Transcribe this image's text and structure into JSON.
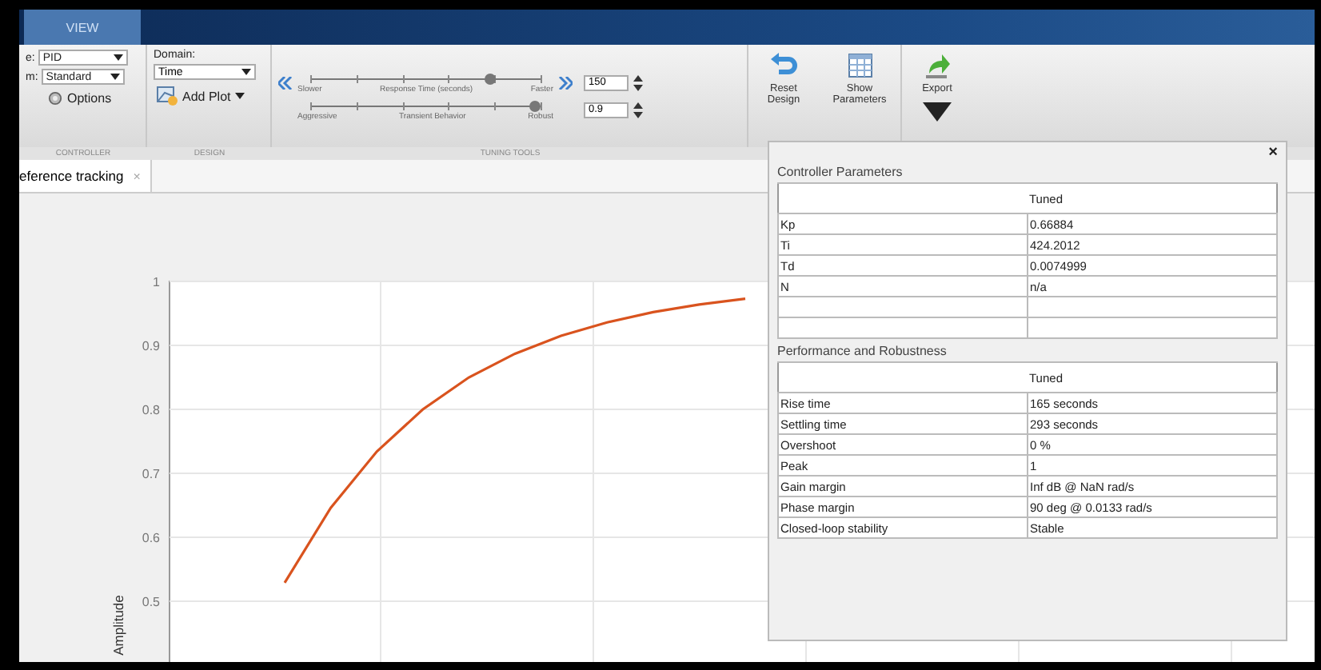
{
  "ribbon_tabs": [
    {
      "label": "VIEW",
      "selected": true
    }
  ],
  "controller": {
    "type_label": "e:",
    "type_value": "PID",
    "form_label": "m:",
    "form_value": "Standard",
    "options_button": "Options",
    "section": "CONTROLLER"
  },
  "design": {
    "domain_label": "Domain:",
    "domain_value": "Time",
    "add_plot_button": "Add Plot",
    "section": "DESIGN"
  },
  "tuning_tools": {
    "section": "TUNING TOOLS",
    "sliders": [
      {
        "left": "Slower",
        "center": "Response Time (seconds)",
        "right": "Faster",
        "level": 0.78,
        "value": "150"
      },
      {
        "left": "Aggressive",
        "center": "Transient Behavior",
        "right": "Robust",
        "level": 0.97,
        "value": "0.9"
      }
    ]
  },
  "buttons": [
    {
      "kind": "reset",
      "label": "Reset Design"
    },
    {
      "kind": "table",
      "label": "Show Parameters"
    },
    {
      "kind": "export",
      "label": "Export"
    }
  ],
  "document_tabs": [
    {
      "label": "eference tracking",
      "close": "×",
      "selected": true
    }
  ],
  "plot": {
    "chart_data": {
      "type": "line",
      "ylabel": "Amplitude",
      "ylim": [
        0.4,
        1
      ],
      "categories": [
        null,
        null,
        null,
        null,
        null,
        null,
        null,
        null,
        null,
        null,
        null,
        null,
        null,
        null,
        null,
        null,
        null,
        null,
        null,
        null,
        null,
        null,
        null,
        null,
        null
      ],
      "grid": true,
      "series": [
        {
          "color": "#d9531e",
          "values": [
            null,
            null,
            0.529,
            0.646,
            0.734,
            0.8,
            0.85,
            0.887,
            0.915,
            0.936,
            0.952,
            0.964,
            0.973,
            null,
            null,
            null,
            null,
            null,
            null,
            null,
            null,
            null,
            null,
            null,
            null
          ]
        }
      ],
      "yticks": [
        {
          "value": 0.5,
          "label": "0.5"
        },
        {
          "value": 0.6,
          "label": "0.6"
        },
        {
          "value": 0.7,
          "label": "0.7"
        },
        {
          "value": 0.8,
          "label": "0.8"
        },
        {
          "value": 0.9,
          "label": "0.9"
        },
        {
          "value": 1,
          "label": "1"
        }
      ]
    }
  },
  "parameters_panel": {
    "close": "×",
    "tables": [
      {
        "kind": "parameters",
        "title": "Controller Parameters",
        "header": "Tuned",
        "rows": [
          {
            "name": "Kp",
            "value": "0.66884"
          },
          {
            "name": "Ti",
            "value": "424.2012"
          },
          {
            "name": "Td",
            "value": "0.0074999"
          },
          {
            "name": "N",
            "value": "n/a"
          }
        ]
      },
      {
        "kind": "performance",
        "title": "Performance and Robustness",
        "header": "Tuned",
        "rows": [
          {
            "name": "Rise time",
            "value": "165 seconds"
          },
          {
            "name": "Settling time",
            "value": "293 seconds"
          },
          {
            "name": "Overshoot",
            "value": "0 %"
          },
          {
            "name": "Peak",
            "value": "1"
          },
          {
            "name": "Gain margin",
            "value": "Inf dB @ NaN rad/s"
          },
          {
            "name": "Phase margin",
            "value": "90 deg @ 0.0133 rad/s"
          },
          {
            "name": "Closed-loop stability",
            "value": "Stable"
          }
        ]
      }
    ]
  }
}
